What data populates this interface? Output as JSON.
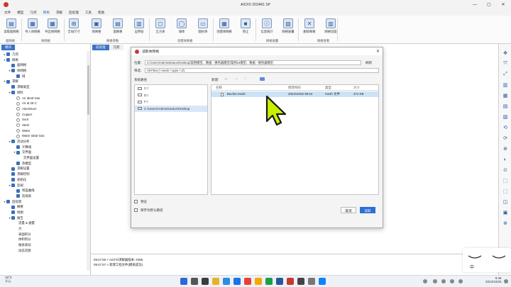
{
  "window": {
    "title": "AICFD 2024R1 SP",
    "minimize": "—",
    "maximize": "▢",
    "close": "✕"
  },
  "menu": [
    "文件",
    "模型",
    "几何",
    "网格",
    "求解",
    "后处理",
    "工具",
    "帮助"
  ],
  "ribbon": {
    "buttons": [
      "读取面网格",
      "导入体网格",
      "导出体网格",
      "全局尺寸",
      "体网格",
      "面网格",
      "边界层",
      "立方体",
      "球体",
      "圆柱体",
      "创建体网格",
      "停止",
      "信息统计",
      "网格质量",
      "删除网格",
      "网格切面"
    ],
    "groups": [
      "面网格",
      "体网格",
      "网格参数",
      "创建体网格",
      "网格质量",
      "网格查看"
    ]
  },
  "left_panel": {
    "tab": "模块",
    "tree": [
      {
        "label": "几何",
        "level": 0,
        "expander": "▸",
        "icon": "tree"
      },
      {
        "label": "网格",
        "level": 0,
        "expander": "▾",
        "icon": "tree"
      },
      {
        "label": "面网格",
        "level": 1,
        "expander": "",
        "icon": "tree"
      },
      {
        "label": "体网格",
        "level": 1,
        "expander": "▾",
        "icon": "tree"
      },
      {
        "label": "域",
        "level": 2,
        "expander": "",
        "icon": "tree"
      },
      {
        "label": "求解",
        "level": 0,
        "expander": "▾",
        "icon": "tree"
      },
      {
        "label": "求解类型",
        "level": 1,
        "expander": "",
        "icon": "tree"
      },
      {
        "label": "材料",
        "level": 1,
        "expander": "▾",
        "icon": "tree"
      },
      {
        "label": "Air Ideal Gas",
        "level": 2,
        "expander": "",
        "icon": "mat"
      },
      {
        "label": "Air at 25 C",
        "level": 2,
        "expander": "",
        "icon": "mat"
      },
      {
        "label": "Aluminium",
        "level": 2,
        "expander": "",
        "icon": "mat"
      },
      {
        "label": "Copper",
        "level": 2,
        "expander": "",
        "icon": "mat"
      },
      {
        "label": "Soot",
        "level": 2,
        "expander": "",
        "icon": "mat"
      },
      {
        "label": "Steel",
        "level": 2,
        "expander": "",
        "icon": "mat"
      },
      {
        "label": "Water",
        "level": 2,
        "expander": "",
        "icon": "mat"
      },
      {
        "label": "Water Ideal Gas",
        "level": 2,
        "expander": "",
        "icon": "mat"
      },
      {
        "label": "流动分析",
        "level": 1,
        "expander": "▾",
        "icon": "tree"
      },
      {
        "label": "计算域",
        "level": 2,
        "expander": "",
        "icon": "tree"
      },
      {
        "label": "交界面",
        "level": 2,
        "expander": "▾",
        "icon": "tree"
      },
      {
        "label": "交界面设置",
        "level": 3,
        "expander": "",
        "icon": "none"
      },
      {
        "label": "热模型",
        "level": 2,
        "expander": "",
        "icon": "tree"
      },
      {
        "label": "求解设置",
        "level": 1,
        "expander": "",
        "icon": "tree"
      },
      {
        "label": "求解控制",
        "level": 1,
        "expander": "",
        "icon": "tree"
      },
      {
        "label": "初始化",
        "level": 1,
        "expander": "",
        "icon": "tree"
      },
      {
        "label": "监视",
        "level": 1,
        "expander": "▾",
        "icon": "tree"
      },
      {
        "label": "残差曲线",
        "level": 2,
        "expander": "",
        "icon": "tree"
      },
      {
        "label": "监视表",
        "level": 2,
        "expander": "",
        "icon": "tree"
      },
      {
        "label": "后处理",
        "level": 0,
        "expander": "▾",
        "icon": "tree"
      },
      {
        "label": "摘要",
        "level": 1,
        "expander": "",
        "icon": "tree"
      },
      {
        "label": "绘图",
        "level": 1,
        "expander": "",
        "icon": "tree"
      },
      {
        "label": "报告",
        "level": 1,
        "expander": "▾",
        "icon": "tree"
      },
      {
        "label": "流量 & 通量",
        "level": 2,
        "expander": "",
        "icon": "none"
      },
      {
        "label": "力",
        "level": 2,
        "expander": "",
        "icon": "none"
      },
      {
        "label": "表面积分",
        "level": 2,
        "expander": "",
        "icon": "none"
      },
      {
        "label": "体积积分",
        "level": 2,
        "expander": "",
        "icon": "none"
      },
      {
        "label": "报表滚动",
        "level": 2,
        "expander": "",
        "icon": "none"
      },
      {
        "label": "动态云图",
        "level": 2,
        "expander": "",
        "icon": "none"
      }
    ]
  },
  "center_tabs": [
    "前处理",
    "几何"
  ],
  "console": {
    "lines": [
      "09:47:56 > AICFD求解器版本: #285",
      "09:47:57 > 新建工程文件(模拟成功)."
    ]
  },
  "dialog": {
    "title": "读取体网格",
    "close": "✕",
    "location_label": "位置:",
    "location_value": "C:/Users/Administrator/Desktop/案例模型、数据 - 换热器模型/案例15模型、数据 - 换热器模型",
    "refresh": "刷新",
    "filter_label": "筛选:",
    "filter_value": "All Files (*.mesh *.cgns *.cf)",
    "nav_label": "系统路径",
    "new_label": "新建:",
    "places": [
      "C:/",
      "D:/",
      "F:/",
      "C:/Users/Administrator/Desktop"
    ],
    "selected_place": 3,
    "columns": [
      "名称",
      "修改时间",
      "类型",
      "大小"
    ],
    "file": {
      "name": "Bucher.mesh",
      "modified": "2024/10/25 09:44",
      "type": "mesh 文件",
      "size": "471 KB"
    },
    "checkbox_preview": "预览",
    "checkbox_default": "保存为默认路径",
    "cancel": "取消",
    "open": "读取"
  },
  "ime": {
    "text": "中"
  },
  "taskbar": {
    "weather_temp": "19°C",
    "weather_desc": "多云",
    "time": "9:48",
    "date": "2024/10/25"
  },
  "colors": {
    "accent": "#2d6fd2",
    "cursor": "#c8f000",
    "title_logo": "#c43a2f"
  }
}
